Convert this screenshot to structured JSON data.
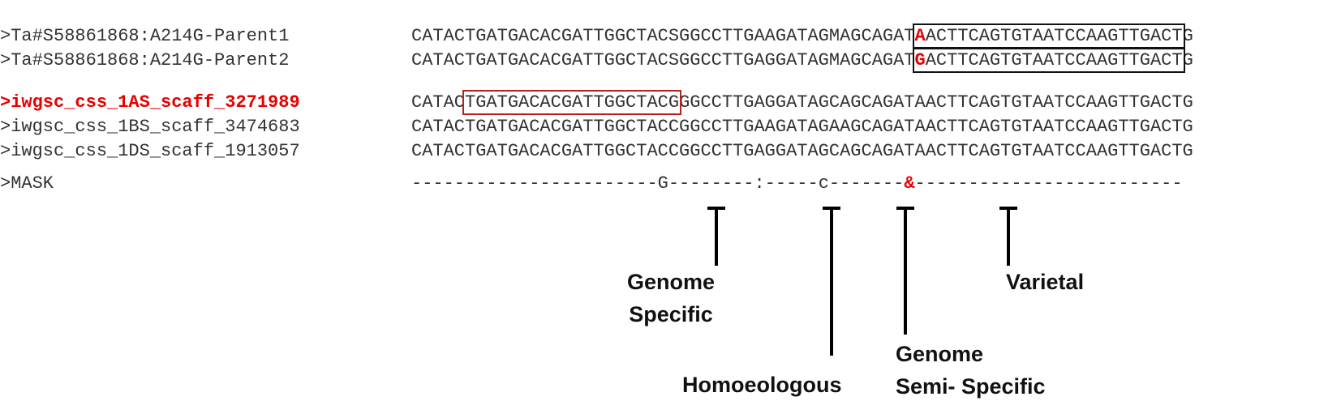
{
  "rows": [
    {
      "label": ">Ta#S58861868:A214G-Parent1",
      "seq_a": "CATACTGATGACACGATTGGCTACSGGCCTTGAAGATAGMAGCAGAT",
      "snp": "A",
      "seq_box": "ACTTCAGTGTAATCCAAGTTGACT",
      "seq_end": "G"
    },
    {
      "label": ">Ta#S58861868:A214G-Parent2",
      "seq_a": "CATACTGATGACACGATTGGCTACSGGCCTTGAGGATAGMAGCAGAT",
      "snp": "G",
      "seq_box": "ACTTCAGTGTAATCCAAGTTGACT",
      "seq_end": "G"
    },
    {
      "label": ">iwgsc_css_1AS_scaff_3271989",
      "seq_pre": "CATAC",
      "seq_box": "TGATGACACGATTGGCTACG",
      "seq_post": "GGCCTTGAGGATAGCAGCAGATAACTTCAGTGTAATCCAAGTTGACTG"
    },
    {
      "label": ">iwgsc_css_1BS_scaff_3474683",
      "seq": "CATACTGATGACACGATTGGCTACCGGCCTTGAAGATAGAAGCAGATAACTTCAGTGTAATCCAAGTTGACTG"
    },
    {
      "label": ">iwgsc_css_1DS_scaff_1913057",
      "seq": "CATACTGATGACACGATTGGCTACCGGCCTTGAGGATAGCAGCAGATAACTTCAGTGTAATCCAAGTTGACTG"
    }
  ],
  "mask": {
    "label": ">MASK",
    "seg1": "-----------------------",
    "g": "G",
    "seg2": "--------",
    "colon": ":",
    "seg3": "-----",
    "c": "c",
    "seg4": "-------",
    "amp": "&",
    "seg5": "-------------------------"
  },
  "annotations": {
    "genome_specific": "Genome\nSpecific",
    "homoeologous": "Homoeologous",
    "semi_specific": "Genome\nSemi- Specific",
    "varietal": "Varietal"
  },
  "colors": {
    "highlight": "#e60000",
    "primer_box": "#b22222",
    "probe_box": "#111111",
    "text": "#333333"
  }
}
